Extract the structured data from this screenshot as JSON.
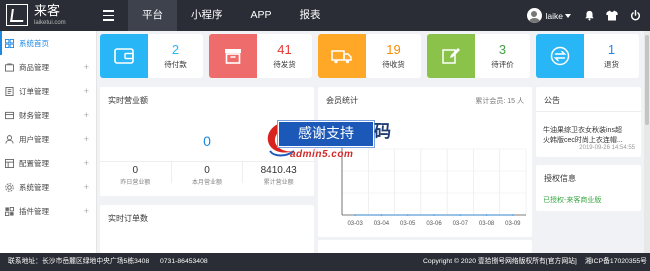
{
  "app": {
    "logo_text": "来客",
    "logo_sub": "laiketui.com"
  },
  "nav": {
    "items": [
      "平台",
      "小程序",
      "APP",
      "报表"
    ],
    "active_index": 0
  },
  "user": {
    "name": "laike"
  },
  "sidebar": {
    "items": [
      {
        "label": "系统首页",
        "icon": "home-icon",
        "active": true,
        "expandable": false
      },
      {
        "label": "商品管理",
        "icon": "product-icon",
        "active": false,
        "expandable": true
      },
      {
        "label": "订单管理",
        "icon": "order-icon",
        "active": false,
        "expandable": true
      },
      {
        "label": "财务管理",
        "icon": "finance-icon",
        "active": false,
        "expandable": true
      },
      {
        "label": "用户管理",
        "icon": "user-icon",
        "active": false,
        "expandable": true
      },
      {
        "label": "配置管理",
        "icon": "config-icon",
        "active": false,
        "expandable": true
      },
      {
        "label": "系统管理",
        "icon": "system-icon",
        "active": false,
        "expandable": true
      },
      {
        "label": "插件管理",
        "icon": "plugin-icon",
        "active": false,
        "expandable": true
      }
    ]
  },
  "stats": [
    {
      "value": "2",
      "label": "待付款",
      "icon": "wallet-icon",
      "color": "#29b6f6",
      "value_color": "#29b6f6"
    },
    {
      "value": "41",
      "label": "待发货",
      "icon": "box-icon",
      "color": "#ef6c6c",
      "value_color": "#e53935"
    },
    {
      "value": "19",
      "label": "待收货",
      "icon": "truck-icon",
      "color": "#ffa726",
      "value_color": "#fb8c00"
    },
    {
      "value": "3",
      "label": "待评价",
      "icon": "edit-icon",
      "color": "#8bc34a",
      "value_color": "#43a047"
    },
    {
      "value": "1",
      "label": "退货",
      "icon": "exchange-icon",
      "color": "#29b6f6",
      "value_color": "#1e88e5"
    }
  ],
  "revenue": {
    "title": "实时营业额",
    "total": "0",
    "cells": [
      {
        "value": "0",
        "label": "昨日营业额"
      },
      {
        "value": "0",
        "label": "本月营业额"
      },
      {
        "value": "8410.43",
        "label": "累计营业额"
      }
    ]
  },
  "members": {
    "title": "会员统计",
    "total_text": "累计会员: 15 人"
  },
  "chart_data": {
    "type": "line",
    "x": [
      "03-03",
      "03-04",
      "03-05",
      "03-06",
      "03-07",
      "03-08",
      "03-09"
    ],
    "series": [
      {
        "values": [
          0,
          0,
          0,
          0,
          0,
          0,
          0
        ]
      }
    ],
    "grid": true
  },
  "notice": {
    "title": "公告",
    "lines": [
      "牛油果综卫衣女秋装ins超",
      "火韩版cec时尚上衣连帽..."
    ],
    "date": "2019-09-26 14:54:55"
  },
  "auth": {
    "title": "授权信息",
    "text": "已授权-来客商业版"
  },
  "orders": {
    "title": "实时订单数"
  },
  "watermark": {
    "banner": "感谢支持",
    "right": "码",
    "url": "admin5.com"
  },
  "footer": {
    "contact": "联系地址：长沙市岳麓区绿地中央广场5栋3408",
    "phone": "0731-86453408",
    "copyright": "Copyright © 2020 壹拾捌号网络版权所有[官方网站]",
    "icp": "湘ICP备17020355号"
  },
  "colors": {
    "topbar": "#2a2d35",
    "accent": "#1e88e5"
  }
}
